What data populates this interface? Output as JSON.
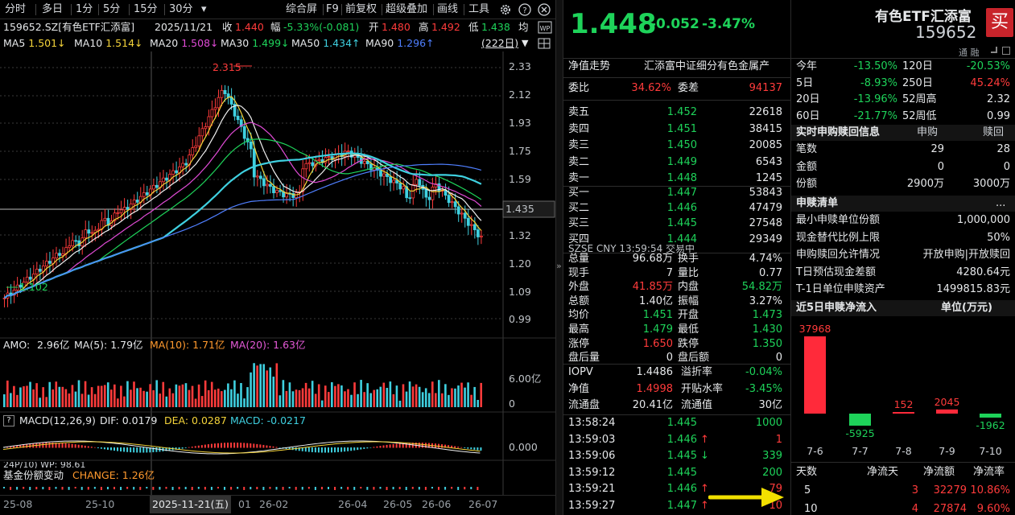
{
  "toolbar": {
    "periods": [
      "分时",
      "多日",
      "1分",
      "5分",
      "15分",
      "30分"
    ],
    "more": "▾",
    "actions": [
      "综合屏",
      "F9",
      "前复权",
      "超级叠加",
      "画线",
      "工具"
    ]
  },
  "quote_line": {
    "code": "159652.SZ[有色ETF汇添富]",
    "date": "2025/11/21",
    "close_label": "收",
    "close": "1.440",
    "chg_label": "幅",
    "chg": "-5.33%(-0.081)",
    "open_label": "开",
    "open": "1.480",
    "high_label": "高",
    "high": "1.492",
    "low_label": "低",
    "low": "1.438",
    "avg_label": "均"
  },
  "ma_line": [
    {
      "label": "MA5",
      "value": "1.501↓",
      "color": "#f5d43a"
    },
    {
      "label": "MA10",
      "value": "1.514↓",
      "color": "#f5d43a"
    },
    {
      "label": "MA20",
      "value": "1.508↓",
      "color": "#e04bd6"
    },
    {
      "label": "MA30",
      "value": "1.499↓",
      "color": "#1ed35a"
    },
    {
      "label": "MA50",
      "value": "1.434↑",
      "color": "#3fd0e0"
    },
    {
      "label": "MA90",
      "value": "1.296↑",
      "color": "#4f7fff"
    }
  ],
  "range_btn": "(222日)",
  "y_ticks": [
    "2.33",
    "2.12",
    "1.93",
    "1.75",
    "1.59",
    "1.45",
    "1.32",
    "1.20",
    "1.09",
    "0.99"
  ],
  "current_price_tag": "1.435",
  "high_mark": "2.315",
  "low_mark": "1.102",
  "amo": {
    "label": "AMO:",
    "value": "2.96亿",
    "ma5": "MA(5): 1.79亿",
    "ma10": "MA(10): 1.71亿",
    "ma20": "MA(20): 1.63亿",
    "ytop": "6.00亿",
    "ybot": "0"
  },
  "macd": {
    "q": "?",
    "label": "MACD(12,26,9)",
    "dif": "DIF: 0.0179",
    "dea": "DEA: 0.0287",
    "macd": "MACD: -0.0217",
    "y0": "0.000"
  },
  "fund": {
    "label": "基金份额变动",
    "change": "CHANGE: 1.26亿",
    "partial": "24P/10)    WP: 98.61"
  },
  "x_axis": [
    "25-08",
    "25-10",
    "2025-11-21(五)",
    "01",
    "26-02",
    "26-04",
    "26-05",
    "26-06",
    "26-07"
  ],
  "header": {
    "price": "1.448",
    "chg": "-0.052",
    "pct": "-3.47%",
    "name": "有色ETF汇添富",
    "code": "159652",
    "buy": "买",
    "tags": "通  融"
  },
  "nav_row": {
    "label": "净值走势",
    "index": "汇添富中证细分有色金属产"
  },
  "order": {
    "wb_label": "委比",
    "wb": "34.62%",
    "wc_label": "委差",
    "wc": "94137"
  },
  "asks": [
    {
      "l": "卖五",
      "p": "1.452",
      "v": "22618"
    },
    {
      "l": "卖四",
      "p": "1.451",
      "v": "38415"
    },
    {
      "l": "卖三",
      "p": "1.450",
      "v": "20085"
    },
    {
      "l": "卖二",
      "p": "1.449",
      "v": "6543"
    },
    {
      "l": "卖一",
      "p": "1.448",
      "v": "1245"
    }
  ],
  "bids": [
    {
      "l": "买一",
      "p": "1.447",
      "v": "53843"
    },
    {
      "l": "买二",
      "p": "1.446",
      "v": "47479"
    },
    {
      "l": "买三",
      "p": "1.445",
      "v": "27548"
    },
    {
      "l": "买四",
      "p": "1.444",
      "v": "29349"
    }
  ],
  "mkt_line": "SZSE  CNY  13:59:54  交易中",
  "stats": [
    {
      "l1": "总量",
      "v1": "96.68万",
      "c1": "white",
      "l2": "换手",
      "v2": "4.74%",
      "c2": "white"
    },
    {
      "l1": "现手",
      "v1": "7",
      "c1": "white",
      "l2": "量比",
      "v2": "0.77",
      "c2": "white"
    },
    {
      "l1": "外盘",
      "v1": "41.85万",
      "c1": "red",
      "l2": "内盘",
      "v2": "54.82万",
      "c2": "green"
    },
    {
      "l1": "总额",
      "v1": "1.40亿",
      "c1": "white",
      "l2": "振幅",
      "v2": "3.27%",
      "c2": "white"
    },
    {
      "l1": "均价",
      "v1": "1.451",
      "c1": "green",
      "l2": "开盘",
      "v2": "1.473",
      "c2": "green"
    },
    {
      "l1": "最高",
      "v1": "1.479",
      "c1": "green",
      "l2": "最低",
      "v2": "1.430",
      "c2": "green"
    },
    {
      "l1": "涨停",
      "v1": "1.650",
      "c1": "red",
      "l2": "跌停",
      "v2": "1.350",
      "c2": "green"
    },
    {
      "l1": "盘后量",
      "v1": "0",
      "c1": "white",
      "l2": "盘后额",
      "v2": "0",
      "c2": "white"
    }
  ],
  "iopv": [
    {
      "l1": "IOPV",
      "v1": "1.4486",
      "c1": "white",
      "l2": "溢折率",
      "v2": "-0.04%",
      "c2": "green"
    },
    {
      "l1": "净值",
      "v1": "1.4998",
      "c1": "red",
      "l2": "开贴水率",
      "v2": "-3.45%",
      "c2": "green"
    },
    {
      "l1": "流通盘",
      "v1": "20.41亿",
      "c1": "white",
      "l2": "流通值",
      "v2": "30亿",
      "c2": "white"
    }
  ],
  "ticks": [
    {
      "t": "13:58:24",
      "p": "1.445",
      "a": "",
      "v": "1000",
      "vc": "green"
    },
    {
      "t": "13:59:03",
      "p": "1.446",
      "a": "↑",
      "v": "1",
      "vc": "red"
    },
    {
      "t": "13:59:06",
      "p": "1.445",
      "a": "↓",
      "v": "339",
      "vc": "green"
    },
    {
      "t": "13:59:12",
      "p": "1.445",
      "a": "",
      "v": "200",
      "vc": "green"
    },
    {
      "t": "13:59:21",
      "p": "1.446",
      "a": "↑",
      "v": "79",
      "vc": "red"
    },
    {
      "t": "13:59:27",
      "p": "1.447",
      "a": "↑",
      "v": "10",
      "vc": "red"
    }
  ],
  "perf": [
    {
      "l1": "今年",
      "v1": "-13.50%",
      "c1": "green",
      "l2": "120日",
      "v2": "-20.53%",
      "c2": "green"
    },
    {
      "l1": "5日",
      "v1": "-8.93%",
      "c1": "green",
      "l2": "250日",
      "v2": "45.24%",
      "c2": "red"
    },
    {
      "l1": "20日",
      "v1": "-13.96%",
      "c1": "green",
      "l2": "52周高",
      "v2": "2.32",
      "c2": "white"
    },
    {
      "l1": "60日",
      "v1": "-21.77%",
      "c1": "green",
      "l2": "52周低",
      "v2": "0.99",
      "c2": "white"
    }
  ],
  "redeem": {
    "title": "实时申购赎回信息",
    "col1": "申购",
    "col2": "赎回",
    "rows": [
      {
        "l": "笔数",
        "a": "29",
        "b": "28"
      },
      {
        "l": "金额",
        "a": "0",
        "b": "0"
      },
      {
        "l": "份额",
        "a": "2900万",
        "b": "3000万"
      }
    ]
  },
  "list": {
    "title": "申赎清单",
    "more": "...",
    "rows": [
      {
        "l": "最小申赎单位份额",
        "v": "1,000,000"
      },
      {
        "l": "现金替代比例上限",
        "v": "50%"
      },
      {
        "l": "申购赎回允许情况",
        "v": "开放申购|开放赎回"
      },
      {
        "l": "T日预估现金差额",
        "v": "4280.64元"
      },
      {
        "l": "T-1日单位申赎资产",
        "v": "1499815.83元"
      }
    ]
  },
  "flow": {
    "title": "近5日申赎净流入",
    "unit": "单位(万元)"
  },
  "chart_data": {
    "type": "bar",
    "categories": [
      "7-6",
      "7-7",
      "7-8",
      "7-9",
      "7-10"
    ],
    "values": [
      37968,
      -5925,
      152,
      2045,
      -1962
    ],
    "title": "近5日申赎净流入",
    "ylabel": "单位(万元)"
  },
  "flow_table": {
    "headers": [
      "天数",
      "净流天",
      "净流额",
      "净流率"
    ],
    "rows": [
      {
        "d": "5",
        "n": "3",
        "a": "32279",
        "r": "10.86%"
      },
      {
        "d": "10",
        "n": "4",
        "a": "27874",
        "r": "9.60%"
      }
    ]
  }
}
